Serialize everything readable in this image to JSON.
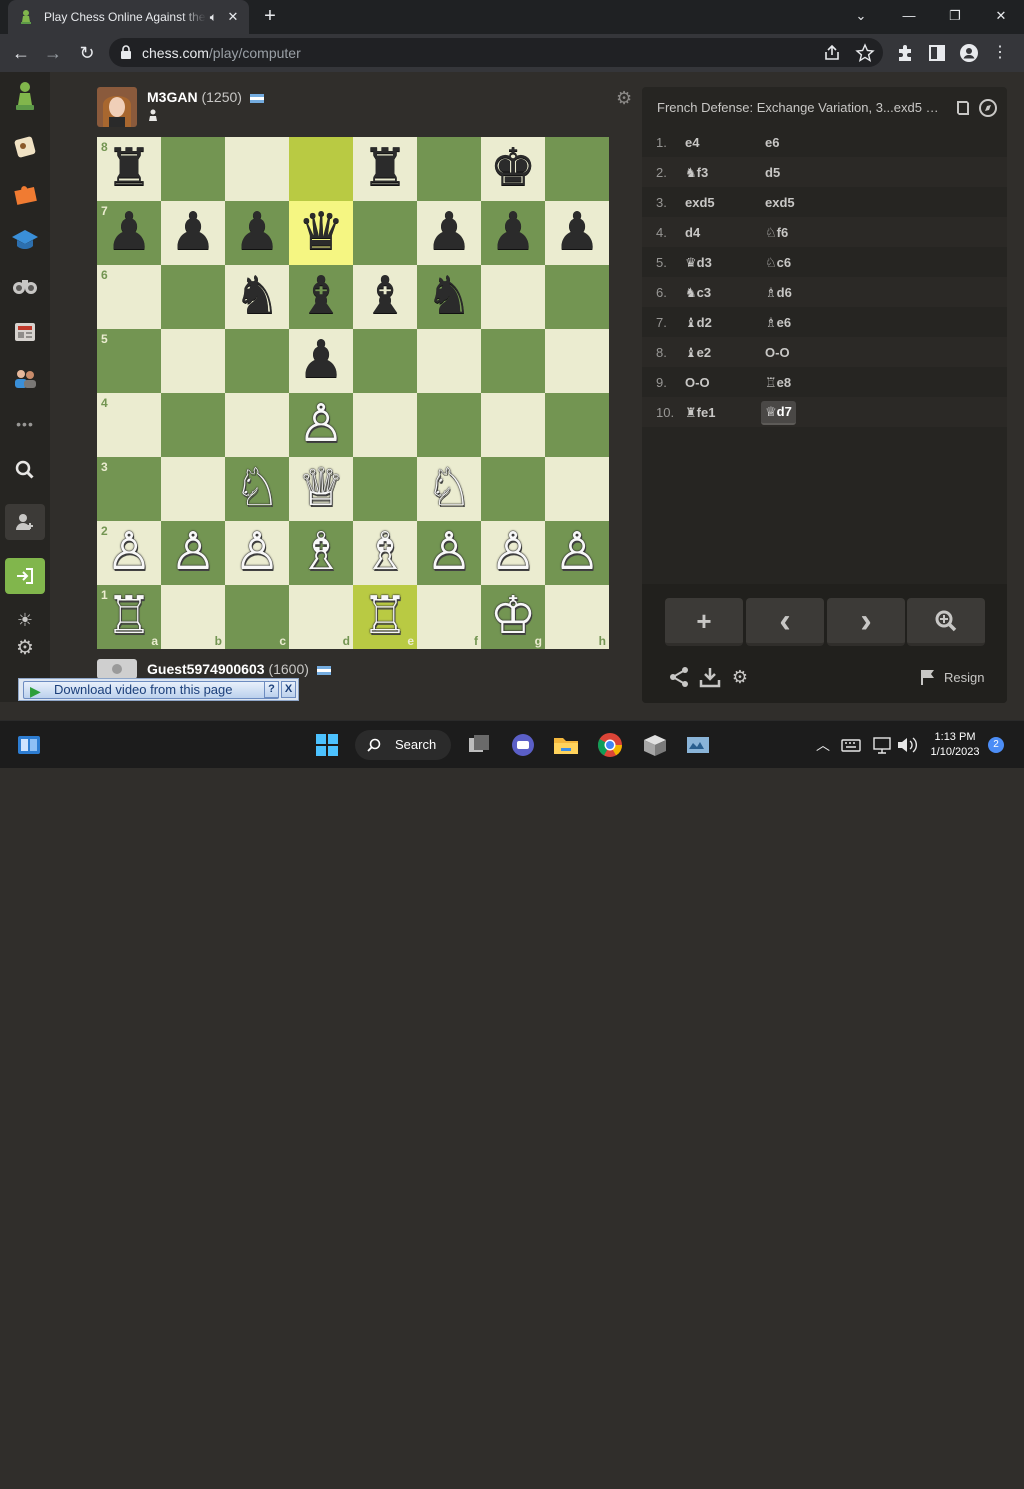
{
  "browser": {
    "tab_title": "Play Chess Online Against the Computer",
    "url_host": "chess.com",
    "url_path": "/play/computer",
    "tab_close_glyph": "✕",
    "new_tab_glyph": "+",
    "minimize_glyph": "—",
    "maximize_glyph": "❐",
    "close_glyph": "✕",
    "chevron_glyph": "⌄",
    "back_glyph": "←",
    "forward_glyph": "→",
    "reload_glyph": "↻",
    "audio_glyph": "🔈︎"
  },
  "sidebar": {
    "icons": [
      "chess-com-logo-icon",
      "play-icon",
      "puzzles-icon",
      "learn-icon",
      "watch-icon",
      "news-icon",
      "social-icon",
      "more-icon",
      "search-icon",
      "signup-icon",
      "login-icon",
      "theme-icon",
      "settings-icon"
    ],
    "more_glyph": "•••",
    "search_glyph": "🔍︎",
    "theme_glyph": "☀",
    "settings_glyph": "⚙"
  },
  "opponent": {
    "name": "M3GAN",
    "rating": "(1250)"
  },
  "player": {
    "name": "Guest5974900603",
    "rating": "(1600)"
  },
  "board": {
    "files": [
      "a",
      "b",
      "c",
      "d",
      "e",
      "f",
      "g",
      "h"
    ],
    "ranks": [
      "8",
      "7",
      "6",
      "5",
      "4",
      "3",
      "2",
      "1"
    ],
    "highlight_squares": [
      "d8",
      "d7",
      "e1"
    ],
    "pieces": [
      {
        "sq": "a8",
        "p": "♜",
        "c": "b"
      },
      {
        "sq": "e8",
        "p": "♜",
        "c": "b"
      },
      {
        "sq": "g8",
        "p": "♚",
        "c": "b"
      },
      {
        "sq": "a7",
        "p": "♟",
        "c": "b"
      },
      {
        "sq": "b7",
        "p": "♟",
        "c": "b"
      },
      {
        "sq": "c7",
        "p": "♟",
        "c": "b"
      },
      {
        "sq": "d7",
        "p": "♛",
        "c": "b"
      },
      {
        "sq": "f7",
        "p": "♟",
        "c": "b"
      },
      {
        "sq": "g7",
        "p": "♟",
        "c": "b"
      },
      {
        "sq": "h7",
        "p": "♟",
        "c": "b"
      },
      {
        "sq": "c6",
        "p": "♞",
        "c": "b"
      },
      {
        "sq": "d6",
        "p": "♝",
        "c": "b"
      },
      {
        "sq": "e6",
        "p": "♝",
        "c": "b"
      },
      {
        "sq": "f6",
        "p": "♞",
        "c": "b"
      },
      {
        "sq": "d5",
        "p": "♟",
        "c": "b"
      },
      {
        "sq": "d4",
        "p": "♙",
        "c": "w"
      },
      {
        "sq": "c3",
        "p": "♘",
        "c": "w"
      },
      {
        "sq": "d3",
        "p": "♕",
        "c": "w"
      },
      {
        "sq": "f3",
        "p": "♘",
        "c": "w"
      },
      {
        "sq": "a2",
        "p": "♙",
        "c": "w"
      },
      {
        "sq": "b2",
        "p": "♙",
        "c": "w"
      },
      {
        "sq": "c2",
        "p": "♙",
        "c": "w"
      },
      {
        "sq": "d2",
        "p": "♗",
        "c": "w"
      },
      {
        "sq": "e2",
        "p": "♗",
        "c": "w"
      },
      {
        "sq": "f2",
        "p": "♙",
        "c": "w"
      },
      {
        "sq": "g2",
        "p": "♙",
        "c": "w"
      },
      {
        "sq": "h2",
        "p": "♙",
        "c": "w"
      },
      {
        "sq": "a1",
        "p": "♖",
        "c": "w"
      },
      {
        "sq": "e1",
        "p": "♖",
        "c": "w"
      },
      {
        "sq": "g1",
        "p": "♔",
        "c": "w"
      }
    ]
  },
  "panel": {
    "opening": "French Defense: Exchange Variation, 3...exd5 4...",
    "moves": [
      {
        "n": "1.",
        "wf": "",
        "w": "e4",
        "bf": "",
        "b": "e6"
      },
      {
        "n": "2.",
        "wf": "♞",
        "w": "f3",
        "bf": "",
        "b": "d5"
      },
      {
        "n": "3.",
        "wf": "",
        "w": "exd5",
        "bf": "",
        "b": "exd5"
      },
      {
        "n": "4.",
        "wf": "",
        "w": "d4",
        "bf": "♘",
        "b": "f6"
      },
      {
        "n": "5.",
        "wf": "♛",
        "w": "d3",
        "bf": "♘",
        "b": "c6"
      },
      {
        "n": "6.",
        "wf": "♞",
        "w": "c3",
        "bf": "♗",
        "b": "d6"
      },
      {
        "n": "7.",
        "wf": "♝",
        "w": "d2",
        "bf": "♗",
        "b": "e6"
      },
      {
        "n": "8.",
        "wf": "♝",
        "w": "e2",
        "bf": "",
        "b": "O-O"
      },
      {
        "n": "9.",
        "wf": "",
        "w": "O-O",
        "bf": "♖",
        "b": "e8"
      },
      {
        "n": "10.",
        "wf": "♜",
        "w": "fe1",
        "bf": "♕",
        "b": "d7"
      }
    ],
    "controls": {
      "plus": "+",
      "prev": "‹",
      "next": "›",
      "analysis": "🔍︎"
    },
    "resign_label": "Resign"
  },
  "download_bar": {
    "label": "Download video from this page",
    "help": "?",
    "close": "X"
  },
  "taskbar": {
    "search_label": "Search",
    "time": "1:13 PM",
    "date": "1/10/2023",
    "notifications": "2"
  },
  "colors": {
    "board_light": "#ebecd0",
    "board_dark": "#739552",
    "highlight_light": "#f5f682",
    "highlight_dark": "#b9ca43",
    "accent_green": "#81b64c"
  }
}
